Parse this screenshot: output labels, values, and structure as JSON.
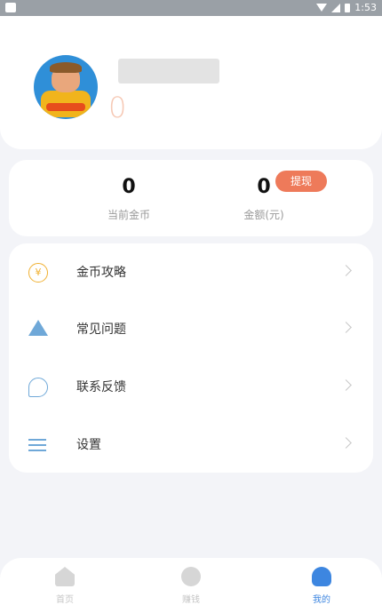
{
  "status_bar": {
    "time": "1:53"
  },
  "profile": {
    "count": "0"
  },
  "coins": {
    "current_coins_value": "0",
    "current_coins_label": "当前金币",
    "amount_value": "0",
    "amount_label": "金额(元)",
    "withdraw_label": "提现"
  },
  "menu": {
    "items": [
      {
        "label": "金币攻略",
        "icon": "coin-icon"
      },
      {
        "label": "常见问题",
        "icon": "warning-icon"
      },
      {
        "label": "联系反馈",
        "icon": "chat-icon"
      },
      {
        "label": "设置",
        "icon": "settings-icon"
      }
    ]
  },
  "tabbar": {
    "tabs": [
      {
        "label": "首页",
        "icon": "home-icon"
      },
      {
        "label": "赚钱",
        "icon": "earn-icon"
      },
      {
        "label": "我的",
        "icon": "profile-icon"
      }
    ]
  },
  "colors": {
    "accent": "#3d86e0",
    "withdraw": "#ee7a5a",
    "gold": "#f0b030"
  }
}
